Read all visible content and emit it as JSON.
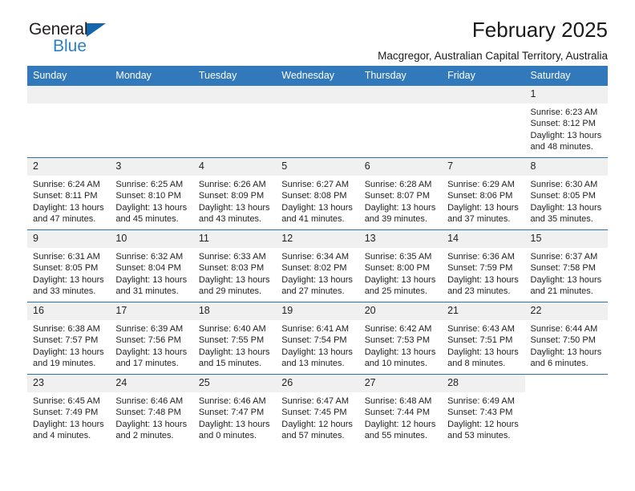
{
  "brand": {
    "name_part1": "General",
    "name_part2": "Blue",
    "triangle_color": "#1565ac",
    "blue_color": "#2f7fc4"
  },
  "header": {
    "title": "February 2025",
    "subtitle": "Macgregor, Australian Capital Territory, Australia",
    "header_bg": "#3279bb",
    "row_divider": "#2f6fa8",
    "daynum_bg": "#f0f0f0"
  },
  "weekdays": [
    "Sunday",
    "Monday",
    "Tuesday",
    "Wednesday",
    "Thursday",
    "Friday",
    "Saturday"
  ],
  "weeks": [
    [
      {
        "day": "",
        "sunrise": "",
        "sunset": "",
        "daylight1": "",
        "daylight2": "",
        "state": "empty"
      },
      {
        "day": "",
        "sunrise": "",
        "sunset": "",
        "daylight1": "",
        "daylight2": "",
        "state": "empty"
      },
      {
        "day": "",
        "sunrise": "",
        "sunset": "",
        "daylight1": "",
        "daylight2": "",
        "state": "empty"
      },
      {
        "day": "",
        "sunrise": "",
        "sunset": "",
        "daylight1": "",
        "daylight2": "",
        "state": "empty"
      },
      {
        "day": "",
        "sunrise": "",
        "sunset": "",
        "daylight1": "",
        "daylight2": "",
        "state": "empty"
      },
      {
        "day": "",
        "sunrise": "",
        "sunset": "",
        "daylight1": "",
        "daylight2": "",
        "state": "empty"
      },
      {
        "day": "1",
        "sunrise": "Sunrise: 6:23 AM",
        "sunset": "Sunset: 8:12 PM",
        "daylight1": "Daylight: 13 hours",
        "daylight2": "and 48 minutes.",
        "state": "filled"
      }
    ],
    [
      {
        "day": "2",
        "sunrise": "Sunrise: 6:24 AM",
        "sunset": "Sunset: 8:11 PM",
        "daylight1": "Daylight: 13 hours",
        "daylight2": "and 47 minutes.",
        "state": "filled"
      },
      {
        "day": "3",
        "sunrise": "Sunrise: 6:25 AM",
        "sunset": "Sunset: 8:10 PM",
        "daylight1": "Daylight: 13 hours",
        "daylight2": "and 45 minutes.",
        "state": "filled"
      },
      {
        "day": "4",
        "sunrise": "Sunrise: 6:26 AM",
        "sunset": "Sunset: 8:09 PM",
        "daylight1": "Daylight: 13 hours",
        "daylight2": "and 43 minutes.",
        "state": "filled"
      },
      {
        "day": "5",
        "sunrise": "Sunrise: 6:27 AM",
        "sunset": "Sunset: 8:08 PM",
        "daylight1": "Daylight: 13 hours",
        "daylight2": "and 41 minutes.",
        "state": "filled"
      },
      {
        "day": "6",
        "sunrise": "Sunrise: 6:28 AM",
        "sunset": "Sunset: 8:07 PM",
        "daylight1": "Daylight: 13 hours",
        "daylight2": "and 39 minutes.",
        "state": "filled"
      },
      {
        "day": "7",
        "sunrise": "Sunrise: 6:29 AM",
        "sunset": "Sunset: 8:06 PM",
        "daylight1": "Daylight: 13 hours",
        "daylight2": "and 37 minutes.",
        "state": "filled"
      },
      {
        "day": "8",
        "sunrise": "Sunrise: 6:30 AM",
        "sunset": "Sunset: 8:05 PM",
        "daylight1": "Daylight: 13 hours",
        "daylight2": "and 35 minutes.",
        "state": "filled"
      }
    ],
    [
      {
        "day": "9",
        "sunrise": "Sunrise: 6:31 AM",
        "sunset": "Sunset: 8:05 PM",
        "daylight1": "Daylight: 13 hours",
        "daylight2": "and 33 minutes.",
        "state": "filled"
      },
      {
        "day": "10",
        "sunrise": "Sunrise: 6:32 AM",
        "sunset": "Sunset: 8:04 PM",
        "daylight1": "Daylight: 13 hours",
        "daylight2": "and 31 minutes.",
        "state": "filled"
      },
      {
        "day": "11",
        "sunrise": "Sunrise: 6:33 AM",
        "sunset": "Sunset: 8:03 PM",
        "daylight1": "Daylight: 13 hours",
        "daylight2": "and 29 minutes.",
        "state": "filled"
      },
      {
        "day": "12",
        "sunrise": "Sunrise: 6:34 AM",
        "sunset": "Sunset: 8:02 PM",
        "daylight1": "Daylight: 13 hours",
        "daylight2": "and 27 minutes.",
        "state": "filled"
      },
      {
        "day": "13",
        "sunrise": "Sunrise: 6:35 AM",
        "sunset": "Sunset: 8:00 PM",
        "daylight1": "Daylight: 13 hours",
        "daylight2": "and 25 minutes.",
        "state": "filled"
      },
      {
        "day": "14",
        "sunrise": "Sunrise: 6:36 AM",
        "sunset": "Sunset: 7:59 PM",
        "daylight1": "Daylight: 13 hours",
        "daylight2": "and 23 minutes.",
        "state": "filled"
      },
      {
        "day": "15",
        "sunrise": "Sunrise: 6:37 AM",
        "sunset": "Sunset: 7:58 PM",
        "daylight1": "Daylight: 13 hours",
        "daylight2": "and 21 minutes.",
        "state": "filled"
      }
    ],
    [
      {
        "day": "16",
        "sunrise": "Sunrise: 6:38 AM",
        "sunset": "Sunset: 7:57 PM",
        "daylight1": "Daylight: 13 hours",
        "daylight2": "and 19 minutes.",
        "state": "filled"
      },
      {
        "day": "17",
        "sunrise": "Sunrise: 6:39 AM",
        "sunset": "Sunset: 7:56 PM",
        "daylight1": "Daylight: 13 hours",
        "daylight2": "and 17 minutes.",
        "state": "filled"
      },
      {
        "day": "18",
        "sunrise": "Sunrise: 6:40 AM",
        "sunset": "Sunset: 7:55 PM",
        "daylight1": "Daylight: 13 hours",
        "daylight2": "and 15 minutes.",
        "state": "filled"
      },
      {
        "day": "19",
        "sunrise": "Sunrise: 6:41 AM",
        "sunset": "Sunset: 7:54 PM",
        "daylight1": "Daylight: 13 hours",
        "daylight2": "and 13 minutes.",
        "state": "filled"
      },
      {
        "day": "20",
        "sunrise": "Sunrise: 6:42 AM",
        "sunset": "Sunset: 7:53 PM",
        "daylight1": "Daylight: 13 hours",
        "daylight2": "and 10 minutes.",
        "state": "filled"
      },
      {
        "day": "21",
        "sunrise": "Sunrise: 6:43 AM",
        "sunset": "Sunset: 7:51 PM",
        "daylight1": "Daylight: 13 hours",
        "daylight2": "and 8 minutes.",
        "state": "filled"
      },
      {
        "day": "22",
        "sunrise": "Sunrise: 6:44 AM",
        "sunset": "Sunset: 7:50 PM",
        "daylight1": "Daylight: 13 hours",
        "daylight2": "and 6 minutes.",
        "state": "filled"
      }
    ],
    [
      {
        "day": "23",
        "sunrise": "Sunrise: 6:45 AM",
        "sunset": "Sunset: 7:49 PM",
        "daylight1": "Daylight: 13 hours",
        "daylight2": "and 4 minutes.",
        "state": "filled"
      },
      {
        "day": "24",
        "sunrise": "Sunrise: 6:46 AM",
        "sunset": "Sunset: 7:48 PM",
        "daylight1": "Daylight: 13 hours",
        "daylight2": "and 2 minutes.",
        "state": "filled"
      },
      {
        "day": "25",
        "sunrise": "Sunrise: 6:46 AM",
        "sunset": "Sunset: 7:47 PM",
        "daylight1": "Daylight: 13 hours",
        "daylight2": "and 0 minutes.",
        "state": "filled"
      },
      {
        "day": "26",
        "sunrise": "Sunrise: 6:47 AM",
        "sunset": "Sunset: 7:45 PM",
        "daylight1": "Daylight: 12 hours",
        "daylight2": "and 57 minutes.",
        "state": "filled"
      },
      {
        "day": "27",
        "sunrise": "Sunrise: 6:48 AM",
        "sunset": "Sunset: 7:44 PM",
        "daylight1": "Daylight: 12 hours",
        "daylight2": "and 55 minutes.",
        "state": "filled"
      },
      {
        "day": "28",
        "sunrise": "Sunrise: 6:49 AM",
        "sunset": "Sunset: 7:43 PM",
        "daylight1": "Daylight: 12 hours",
        "daylight2": "and 53 minutes.",
        "state": "filled"
      },
      {
        "day": "",
        "sunrise": "",
        "sunset": "",
        "daylight1": "",
        "daylight2": "",
        "state": "blank"
      }
    ]
  ]
}
